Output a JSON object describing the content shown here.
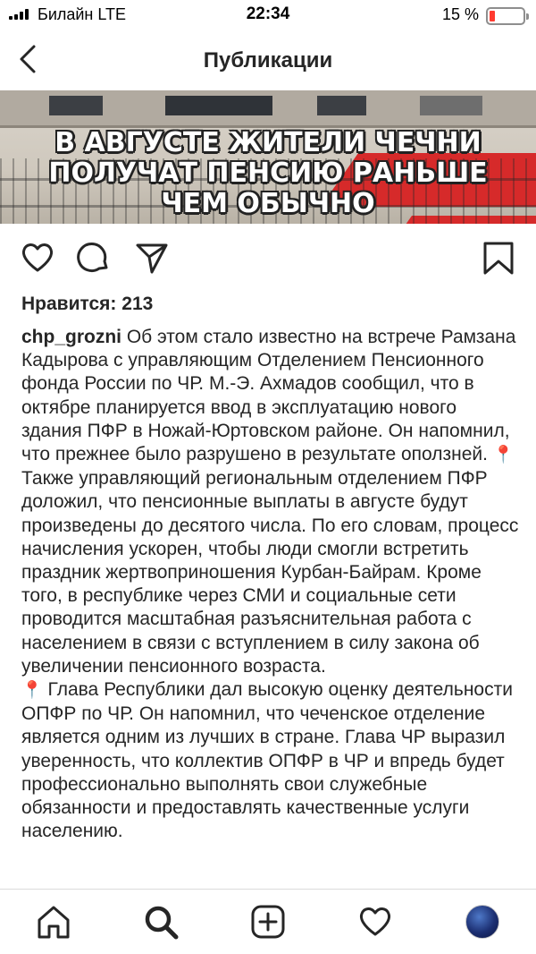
{
  "status_bar": {
    "carrier": "Билайн  LTE",
    "time": "22:34",
    "battery": "15 %"
  },
  "nav": {
    "title": "Публикации"
  },
  "post": {
    "headline": [
      "В АВГУСТЕ ЖИТЕЛИ ЧЕЧНИ",
      "ПОЛУЧАТ ПЕНСИЮ РАНЬШЕ",
      "ЧЕМ ОБЫЧНО"
    ],
    "likes": "Нравится: 213",
    "username": "chp_grozni",
    "caption_1": " Об этом стало известно на встрече Рамзана Кадырова с управляющим Отделением Пенсионного фонда России по ЧР. М.-Э. Ахмадов сообщил, что в октябре планируется ввод в эксплуатацию нового здания ПФР в Ножай-Юртовском районе. Он напомнил, что прежнее было разрушено в результате оползней. ",
    "pin": "📍",
    "caption_2": " Также управляющий региональным отделением ПФР доложил, что пенсионные выплаты в августе будут произведены до десятого числа. По его словам, процесс начисления ускорен, чтобы люди смогли встретить праздник жертвоприношения Курбан-Байрам. Кроме того, в республике через СМИ и социальные сети проводится масштабная разъяснительная работа с населением в связи с вступлением в силу закона об увеличении пенсионного возраста.",
    "caption_3": " Глава Республики дал высокую оценку деятельности ОПФР по ЧР. Он напомнил, что чеченское отделение является одним из лучших в стране. Глава ЧР выразил уверенность, что коллектив ОПФР в ЧР и впредь будет профессионально выполнять свои служебные обязанности и предоставлять качественные услуги населению."
  },
  "icons": {
    "back": "chevron-left-icon",
    "like": "heart-icon",
    "comment": "comment-icon",
    "share": "send-icon",
    "save": "bookmark-icon",
    "tab_home": "home-icon",
    "tab_search": "search-icon",
    "tab_new": "plus-square-icon",
    "tab_activity": "heart-icon",
    "tab_profile": "avatar"
  },
  "colors": {
    "battery_low": "#ff3b30",
    "headline_stripe": "#d62a2a",
    "pin": "#e0245e"
  }
}
